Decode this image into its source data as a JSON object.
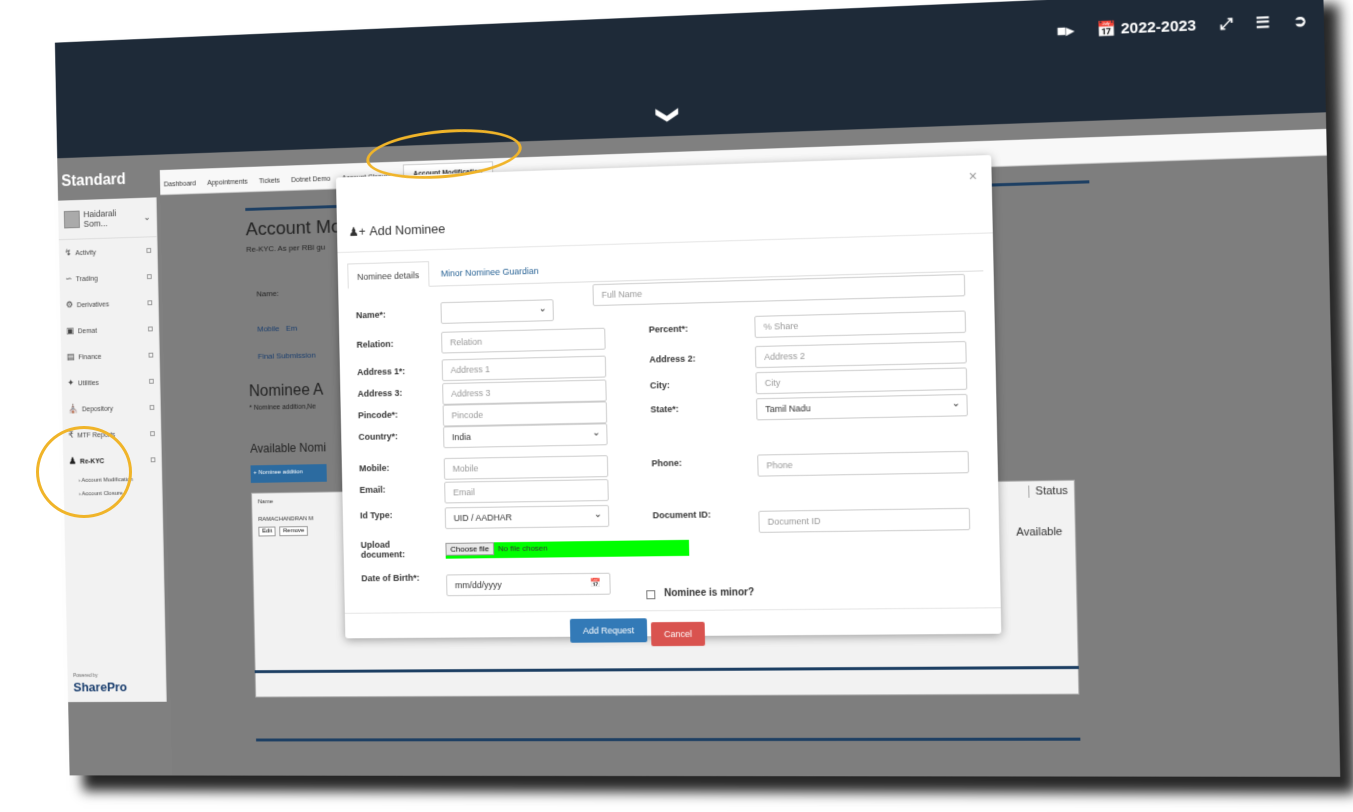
{
  "topbar": {
    "year_label": "2022-2023",
    "icons": [
      "video-icon",
      "calendar-icon",
      "fullscreen-icon",
      "menu-icon",
      "logout-icon"
    ]
  },
  "brand": "Standard",
  "sidebar": {
    "user_name": "Haidarali Som...",
    "items": [
      {
        "label": "Activity",
        "icon": "bolt-icon"
      },
      {
        "label": "Trading",
        "icon": "line-chart-icon"
      },
      {
        "label": "Derivatives",
        "icon": "sitemap-icon"
      },
      {
        "label": "Demat",
        "icon": "cube-icon"
      },
      {
        "label": "Finance",
        "icon": "money-icon"
      },
      {
        "label": "Utilities",
        "icon": "wrench-icon"
      },
      {
        "label": "Depository",
        "icon": "bank-icon"
      },
      {
        "label": "MTF Reports",
        "icon": "rupee-icon"
      },
      {
        "label": "Re-KYC",
        "icon": "user-icon"
      }
    ],
    "sub_items": [
      "Account Modification",
      "Account Closure"
    ],
    "powered_by": "Powered by",
    "product": "SharePro"
  },
  "tabs": [
    "Dashboard",
    "Appointments",
    "Tickets",
    "Dotnet Demo",
    "Account Closure",
    "Account Modification"
  ],
  "background": {
    "title": "Account Mo",
    "note": "Re-KYC. As per RBI gu",
    "name_label": "Name:",
    "mobile_link": "Mobile",
    "email_link": "Em",
    "final_submission": "Final Submission",
    "nominee_heading": "Nominee A",
    "nominee_note": "* Nominee addition,Ne",
    "available_heading": "Available Nomi",
    "add_button": "+ Nominee addition",
    "table_header": "Name",
    "table_row": "RAMACHANDRAN M",
    "edit": "Edit",
    "remove": "Remove",
    "status_header": "Status",
    "status_value": "Available"
  },
  "modal": {
    "title": "Add Nominee",
    "close": "×",
    "tab_active": "Nominee details",
    "tab_other": "Minor Nominee Guardian",
    "name_label": "Name*:",
    "fullname_placeholder": "Full Name",
    "percent_label": "Percent*:",
    "percent_placeholder": "% Share",
    "relation_label": "Relation:",
    "relation_placeholder": "Relation",
    "address1_label": "Address 1*:",
    "address1_placeholder": "Address 1",
    "address2_label": "Address 2:",
    "address2_placeholder": "Address 2",
    "address3_label": "Address 3:",
    "address3_placeholder": "Address 3",
    "city_label": "City:",
    "city_placeholder": "City",
    "pincode_label": "Pincode*:",
    "pincode_placeholder": "Pincode",
    "state_label": "State*:",
    "state_value": "Tamil Nadu",
    "country_label": "Country*:",
    "country_value": "India",
    "mobile_label": "Mobile:",
    "mobile_placeholder": "Mobile",
    "phone_label": "Phone:",
    "phone_placeholder": "Phone",
    "email_label": "Email:",
    "email_placeholder": "Email",
    "idtype_label": "Id Type:",
    "idtype_value": "UID / AADHAR",
    "docid_label": "Document ID:",
    "docid_placeholder": "Document ID",
    "upload_label_1": "Upload",
    "upload_label_2": "document:",
    "choose_file": "Choose file",
    "no_file": "No file chosen",
    "dob_label": "Date of Birth*:",
    "dob_placeholder": "mm/dd/yyyy",
    "minor_label": "Nominee is minor?",
    "add_button": "Add Request",
    "cancel_button": "Cancel"
  }
}
